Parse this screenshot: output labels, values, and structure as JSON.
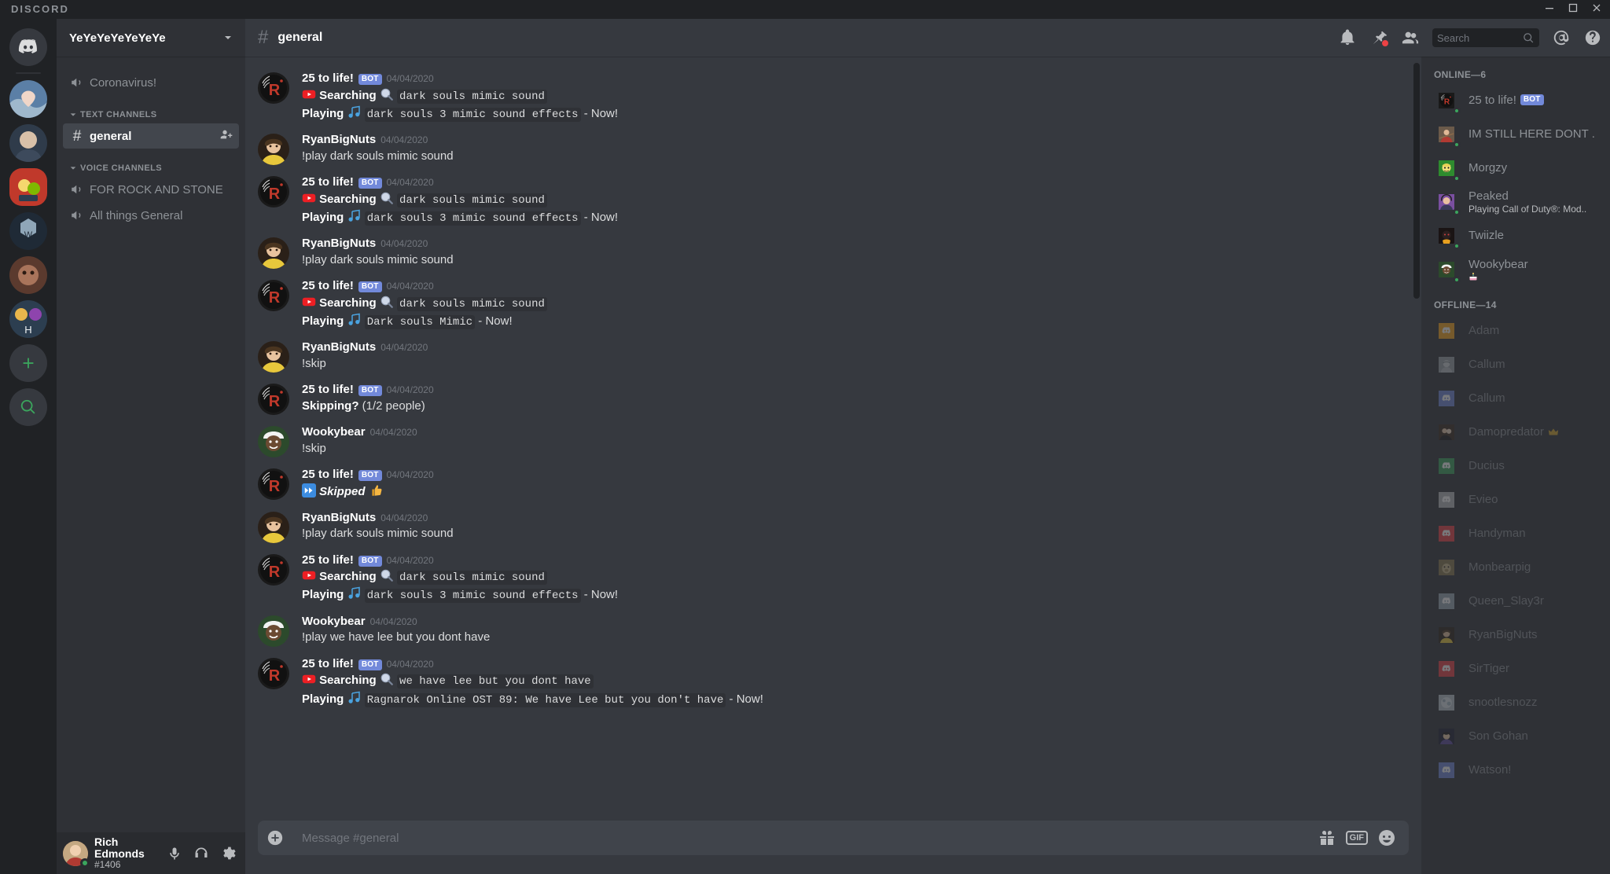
{
  "app": {
    "wordmark": "DISCORD"
  },
  "window": {
    "minimize": "minimize",
    "maximize": "maximize",
    "close": "close"
  },
  "guild_rail": {
    "home_label": "Home",
    "servers": [
      {
        "name": "server-1",
        "color": "#7a9cc6",
        "selected": false
      },
      {
        "name": "server-2",
        "color": "#3e4a5c",
        "selected": false
      },
      {
        "name": "server-3",
        "color": "#c0392b",
        "selected": true
      },
      {
        "name": "server-4",
        "color": "#2c3e50",
        "selected": false
      },
      {
        "name": "server-5",
        "color": "#5b3a2e",
        "selected": false
      },
      {
        "name": "server-6",
        "color": "#34495e",
        "selected": false
      }
    ],
    "add_label": "Add a Server",
    "explore_label": "Explore Public Servers"
  },
  "sidebar": {
    "guild_name": "YeYeYeYeYeYeYe",
    "announce_channel": "Coronavirus!",
    "categories": [
      {
        "label": "TEXT CHANNELS",
        "channels": [
          {
            "name": "general",
            "type": "text",
            "active": true
          }
        ]
      },
      {
        "label": "VOICE CHANNELS",
        "channels": [
          {
            "name": "FOR ROCK AND STONE",
            "type": "voice",
            "active": false
          },
          {
            "name": "All things General",
            "type": "voice",
            "active": false
          }
        ]
      }
    ]
  },
  "user_panel": {
    "name": "Rich Edmonds",
    "tag": "#1406",
    "status": "online",
    "mute_label": "Mute",
    "deafen_label": "Deafen",
    "settings_label": "User Settings"
  },
  "topbar": {
    "channel": "general",
    "icons": [
      {
        "name": "notification-bell-icon",
        "label": "Notification Settings"
      },
      {
        "name": "pinned-messages-icon",
        "label": "Pinned Messages",
        "badge": true
      },
      {
        "name": "member-list-icon",
        "label": "Member List"
      },
      {
        "name": "mentions-icon",
        "label": "Inbox"
      },
      {
        "name": "help-icon",
        "label": "Help"
      }
    ]
  },
  "search": {
    "placeholder": "Search",
    "value": ""
  },
  "composer": {
    "placeholder": "Message #general",
    "value": ""
  },
  "messages": [
    {
      "author": "25 to life!",
      "bot": true,
      "timestamp": "04/04/2020",
      "avatar": "bot",
      "lines": [
        {
          "type": "search",
          "bold": "Searching",
          "code": "dark souls mimic sound"
        },
        {
          "type": "play",
          "bold": "Playing",
          "code": "dark souls 3 mimic sound effects",
          "suffix": " - Now!"
        }
      ]
    },
    {
      "author": "RyanBigNuts",
      "bot": false,
      "timestamp": "04/04/2020",
      "avatar": "ryan",
      "lines": [
        {
          "type": "plain",
          "text": "!play dark souls mimic sound"
        }
      ]
    },
    {
      "author": "25 to life!",
      "bot": true,
      "timestamp": "04/04/2020",
      "avatar": "bot",
      "lines": [
        {
          "type": "search",
          "bold": "Searching",
          "code": "dark souls mimic sound"
        },
        {
          "type": "play",
          "bold": "Playing",
          "code": "dark souls 3 mimic sound effects",
          "suffix": " - Now!"
        }
      ]
    },
    {
      "author": "RyanBigNuts",
      "bot": false,
      "timestamp": "04/04/2020",
      "avatar": "ryan",
      "lines": [
        {
          "type": "plain",
          "text": "!play dark souls mimic sound"
        }
      ]
    },
    {
      "author": "25 to life!",
      "bot": true,
      "timestamp": "04/04/2020",
      "avatar": "bot",
      "lines": [
        {
          "type": "search",
          "bold": "Searching",
          "code": "dark souls mimic sound"
        },
        {
          "type": "play",
          "bold": "Playing",
          "code": "Dark souls Mimic",
          "suffix": " - Now!"
        }
      ]
    },
    {
      "author": "RyanBigNuts",
      "bot": false,
      "timestamp": "04/04/2020",
      "avatar": "ryan",
      "lines": [
        {
          "type": "plain",
          "text": "!skip"
        }
      ]
    },
    {
      "author": "25 to life!",
      "bot": true,
      "timestamp": "04/04/2020",
      "avatar": "bot",
      "lines": [
        {
          "type": "skipping",
          "bold": "Skipping?",
          "text": " (1/2 people)"
        }
      ]
    },
    {
      "author": "Wookybear",
      "bot": false,
      "timestamp": "04/04/2020",
      "avatar": "wooky",
      "lines": [
        {
          "type": "plain",
          "text": "!skip"
        }
      ]
    },
    {
      "author": "25 to life!",
      "bot": true,
      "timestamp": "04/04/2020",
      "avatar": "bot",
      "lines": [
        {
          "type": "skipped",
          "bold": "Skipped"
        }
      ]
    },
    {
      "author": "RyanBigNuts",
      "bot": false,
      "timestamp": "04/04/2020",
      "avatar": "ryan",
      "lines": [
        {
          "type": "plain",
          "text": "!play dark souls mimic sound"
        }
      ]
    },
    {
      "author": "25 to life!",
      "bot": true,
      "timestamp": "04/04/2020",
      "avatar": "bot",
      "lines": [
        {
          "type": "search",
          "bold": "Searching",
          "code": "dark souls mimic sound"
        },
        {
          "type": "play",
          "bold": "Playing",
          "code": "dark souls 3 mimic sound effects",
          "suffix": " - Now!"
        }
      ]
    },
    {
      "author": "Wookybear",
      "bot": false,
      "timestamp": "04/04/2020",
      "avatar": "wooky",
      "lines": [
        {
          "type": "plain",
          "text": "!play we have lee but you dont have"
        }
      ]
    },
    {
      "author": "25 to life!",
      "bot": true,
      "timestamp": "04/04/2020",
      "avatar": "bot",
      "lines": [
        {
          "type": "search",
          "bold": "Searching",
          "code": "we have lee but you dont have"
        },
        {
          "type": "play",
          "bold": "Playing",
          "code": "Ragnarok Online OST 89: We have Lee but you don't have",
          "suffix": " - Now!"
        }
      ]
    }
  ],
  "bot_tag_label": "BOT",
  "members": {
    "online_header": "ONLINE—6",
    "offline_header": "OFFLINE—14",
    "online": [
      {
        "name": "25 to life!",
        "bot": true,
        "avatar": "bot",
        "sub": ""
      },
      {
        "name": "IM STILL HERE DONT ...",
        "bot": false,
        "avatar": "imstill",
        "sub": ""
      },
      {
        "name": "Morgzy",
        "bot": false,
        "avatar": "morgzy",
        "sub": ""
      },
      {
        "name": "Peaked",
        "bot": false,
        "avatar": "peaked",
        "sub": "Playing Call of Duty®: Mod...",
        "sub_icon": true
      },
      {
        "name": "Twiizle",
        "bot": false,
        "avatar": "twiizle",
        "sub": ""
      },
      {
        "name": "Wookybear",
        "bot": false,
        "avatar": "wooky",
        "sub": "🍰"
      }
    ],
    "offline": [
      {
        "name": "Adam",
        "avatar_color": "#faa61a",
        "default_avatar": true
      },
      {
        "name": "Callum",
        "avatar_color": "#a0a0a0",
        "default_avatar": false
      },
      {
        "name": "Callum",
        "avatar_color": "#7289da",
        "default_avatar": true
      },
      {
        "name": "Damopredator 👑",
        "avatar_color": "#4a3728",
        "default_avatar": false
      },
      {
        "name": "Ducius",
        "avatar_color": "#3ba55d",
        "default_avatar": true
      },
      {
        "name": "Evieo",
        "avatar_color": "#b9bbbe",
        "default_avatar": true
      },
      {
        "name": "Handyman",
        "avatar_color": "#ed4245",
        "default_avatar": true
      },
      {
        "name": "Monbearpig",
        "avatar_color": "#8a7a4e",
        "default_avatar": false
      },
      {
        "name": "Queen_Slay3r",
        "avatar_color": "#99aab5",
        "default_avatar": true
      },
      {
        "name": "RyanBigNuts",
        "avatar_color": "#8b5a2b",
        "default_avatar": false
      },
      {
        "name": "SirTiger",
        "avatar_color": "#ed4245",
        "default_avatar": true
      },
      {
        "name": "snootlesnozz",
        "avatar_color": "#99aab5",
        "default_avatar": false
      },
      {
        "name": "Son Gohan",
        "avatar_color": "#2b2d42",
        "default_avatar": false
      },
      {
        "name": "Watson!",
        "avatar_color": "#7289da",
        "default_avatar": true
      }
    ]
  },
  "colors": {
    "brand": "#7289da",
    "online": "#3ba55d",
    "danger": "#ed4245",
    "bg_primary": "#36393f",
    "bg_secondary": "#2f3136",
    "bg_tertiary": "#202225"
  }
}
